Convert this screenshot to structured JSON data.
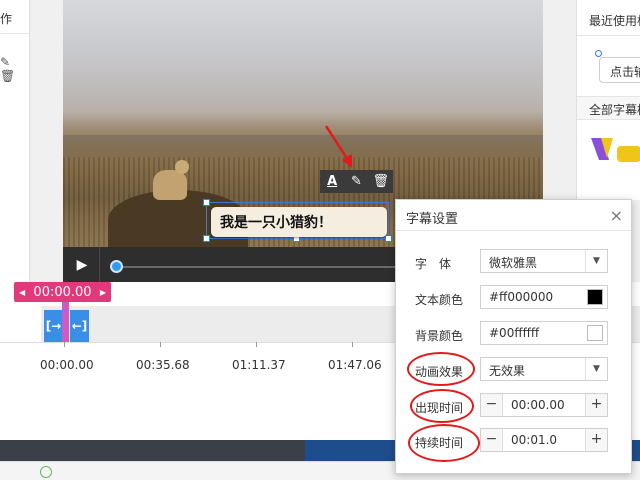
{
  "left_panel": {
    "header_partial": "作",
    "icons": [
      "pencil-icon",
      "trash-icon"
    ]
  },
  "video": {
    "subtitle_text": "我是一只小猎豹！",
    "toolbar": {
      "font_label": "A",
      "icons": [
        "font-icon",
        "pencil-icon",
        "trash-icon"
      ]
    }
  },
  "player": {
    "play_icon": "▶"
  },
  "right_panel": {
    "recent_label": "最近使用标",
    "click_label": "点击输",
    "all_label": "全部字幕样"
  },
  "timeline": {
    "marker_time": "00:00.00",
    "marker_left": "◀",
    "marker_right": "▶",
    "clip_start_icon": "[→",
    "clip_end_icon": "←]",
    "ruler_labels": [
      "00:00.00",
      "00:35.68",
      "01:11.37",
      "01:47.06"
    ]
  },
  "dialog": {
    "title": "字幕设置",
    "close": "×",
    "font_label": "字　体",
    "font_value": "微软雅黑",
    "text_color_label": "文本颜色",
    "text_color_value": "#ff000000",
    "text_color_swatch": "#000000",
    "bg_color_label": "背景颜色",
    "bg_color_value": "#00ffffff",
    "bg_color_swatch": "#ffffff",
    "animation_label": "动画效果",
    "animation_value": "无效果",
    "appear_label": "出现时间",
    "appear_value": "00:00.00",
    "duration_label": "持续时间",
    "duration_value": "00:01.0",
    "minus": "−",
    "plus": "+"
  },
  "colors": {
    "accent_pink": "#e2397a",
    "accent_blue": "#3a8ee6",
    "annotation_red": "#e41a1a"
  }
}
